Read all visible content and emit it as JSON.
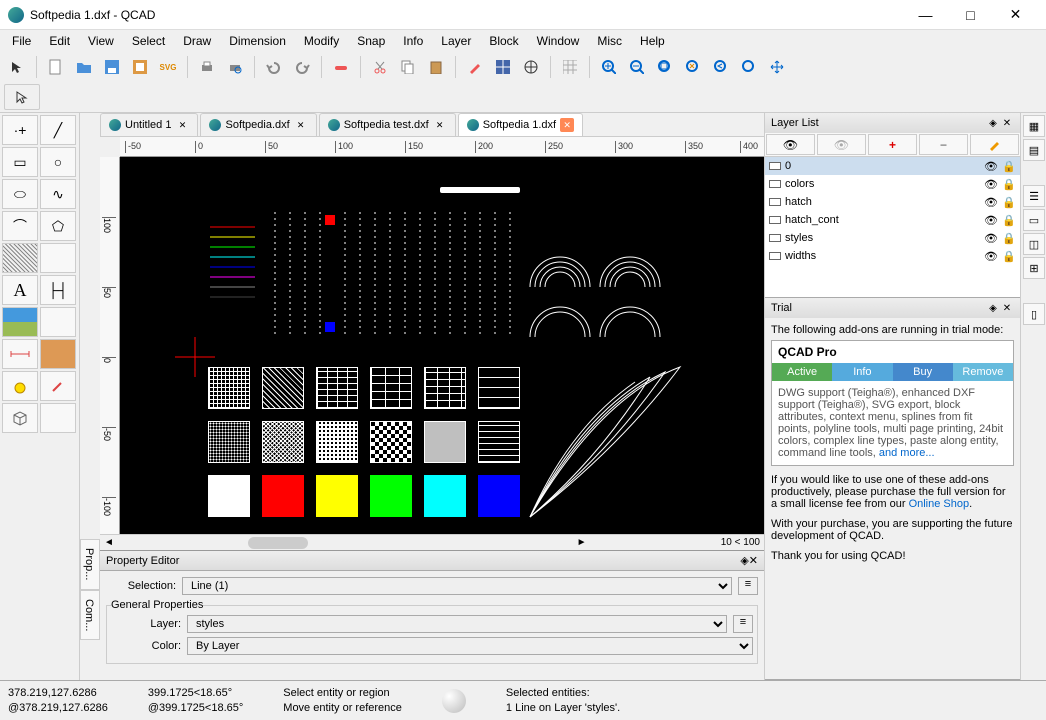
{
  "window": {
    "title": "Softpedia 1.dxf - QCAD"
  },
  "menu": [
    "File",
    "Edit",
    "View",
    "Select",
    "Draw",
    "Dimension",
    "Modify",
    "Snap",
    "Info",
    "Layer",
    "Block",
    "Window",
    "Misc",
    "Help"
  ],
  "tabs": [
    {
      "label": "Untitled 1",
      "active": false
    },
    {
      "label": "Softpedia.dxf",
      "active": false
    },
    {
      "label": "Softpedia test.dxf",
      "active": false
    },
    {
      "label": "Softpedia 1.dxf",
      "active": true,
      "closeActive": true
    }
  ],
  "ruler_h": [
    "-50",
    "0",
    "50",
    "100",
    "150",
    "200",
    "250",
    "300",
    "350",
    "400"
  ],
  "ruler_v": [
    "100",
    "50",
    "0",
    "-50",
    "-100"
  ],
  "scroll_info": "10 < 100",
  "layer_panel": {
    "title": "Layer List",
    "layers": [
      {
        "name": "0",
        "selected": true
      },
      {
        "name": "colors"
      },
      {
        "name": "hatch"
      },
      {
        "name": "hatch_cont"
      },
      {
        "name": "styles"
      },
      {
        "name": "widths"
      }
    ]
  },
  "trial": {
    "title": "Trial",
    "intro": "The following add-ons are running in trial mode:",
    "product": "QCAD Pro",
    "tabs": {
      "active": "Active",
      "info": "Info",
      "buy": "Buy",
      "remove": "Remove"
    },
    "desc": "DWG support (Teigha®), enhanced DXF support (Teigha®), SVG export, block attributes, context menu, splines from fit points, polyline tools, multi page printing, 24bit colors, complex line types, paste along entity, command line tools, ",
    "more": "and more...",
    "text2a": "If you would like to use one of these add-ons productively, please purchase the full version for a small license fee from our ",
    "shop": "Online Shop",
    "text3": "With your purchase, you are supporting the future development of QCAD.",
    "text4": "Thank you for using QCAD!"
  },
  "property_editor": {
    "title": "Property Editor",
    "selection_label": "Selection:",
    "selection": "Line (1)",
    "group": "General Properties",
    "layer_label": "Layer:",
    "layer": "styles",
    "color_label": "Color:",
    "color": "By Layer"
  },
  "status": {
    "abs": "378.219,127.6286",
    "rel": "@378.219,127.6286",
    "pol1": "399.1725<18.65°",
    "pol2": "@399.1725<18.65°",
    "hint1": "Select entity or region",
    "hint2": "Move entity or reference",
    "sel1": "Selected entities:",
    "sel2": "1 Line on Layer 'styles'."
  },
  "left_tools": [
    [
      "point",
      "line"
    ],
    [
      "rect",
      "circle"
    ],
    [
      "ellipse",
      "spline"
    ],
    [
      "arc",
      "polygon"
    ],
    [
      "hatch",
      ""
    ],
    [
      "text",
      "dimlin"
    ],
    [
      "image",
      ""
    ],
    [
      "measure",
      "measure2"
    ],
    [
      "offset",
      "modify"
    ],
    [
      "view3d",
      ""
    ]
  ],
  "sidetabs": [
    "Prop...",
    "Com..."
  ],
  "color_squares": [
    "#ffffff",
    "#ff0000",
    "#ffff00",
    "#00ff00",
    "#00ffff",
    "#0000ff"
  ]
}
